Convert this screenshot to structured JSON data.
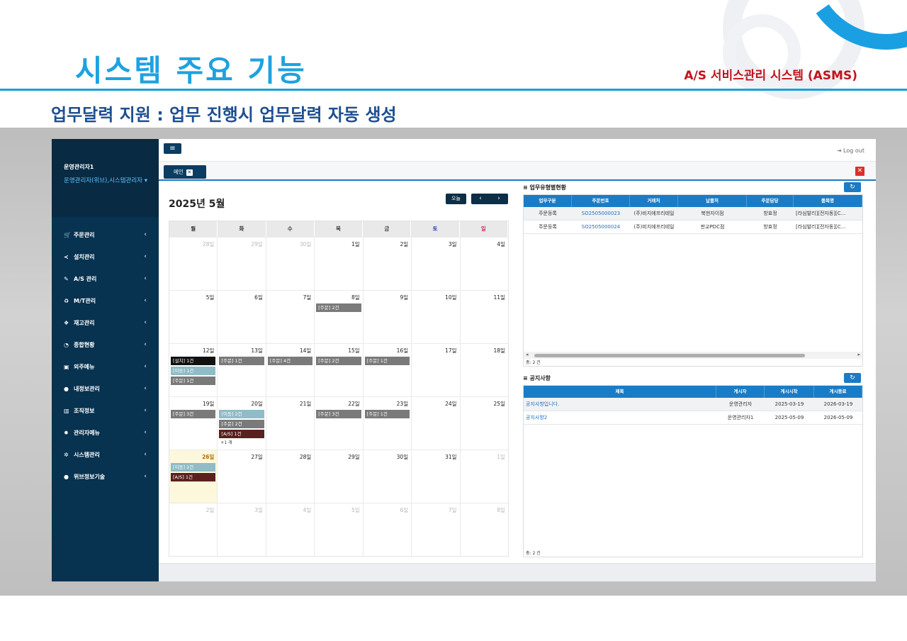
{
  "slide": {
    "title": "시스템 주요 기능",
    "system_name": "A/S 서비스관리 시스템 (ASMS)",
    "subtitle": "업무달력 지원 : 업무 진행시 업무달력 자동 생성"
  },
  "user": {
    "name": "운영관리자1",
    "role": "운영관리자(위브),시스템관리자 ▾"
  },
  "menu": [
    {
      "label": "주문관리",
      "icon": "cart-icon",
      "glyph": "🛒"
    },
    {
      "label": "설치관리",
      "icon": "share-icon",
      "glyph": "≺"
    },
    {
      "label": "A/S 관리",
      "icon": "wrench-icon",
      "glyph": "✎"
    },
    {
      "label": "M/T관리",
      "icon": "recycle-icon",
      "glyph": "♻"
    },
    {
      "label": "재고관리",
      "icon": "cubes-icon",
      "glyph": "❖"
    },
    {
      "label": "종합현황",
      "icon": "pie-chart-icon",
      "glyph": "◔"
    },
    {
      "label": "외주메뉴",
      "icon": "briefcase-icon",
      "glyph": "▣"
    },
    {
      "label": "내정보관리",
      "icon": "user-icon",
      "glyph": "●"
    },
    {
      "label": "조직정보",
      "icon": "building-icon",
      "glyph": "▥"
    },
    {
      "label": "관리자메뉴",
      "icon": "gear-icon",
      "glyph": "✹"
    },
    {
      "label": "시스템관리",
      "icon": "gears-icon",
      "glyph": "✲"
    },
    {
      "label": "위브정보기술",
      "icon": "circle-icon",
      "glyph": "●"
    }
  ],
  "topbar": {
    "menu_toggle": "≡",
    "logout_label": "⇥ Log out"
  },
  "tabs": {
    "main_tab_label": "메인",
    "close_glyph": "✕"
  },
  "calendar": {
    "title": "2025년 5월",
    "today_label": "오늘",
    "prev_glyph": "‹",
    "next_glyph": "›",
    "weekdays": [
      "월",
      "화",
      "수",
      "목",
      "금",
      "토",
      "일"
    ],
    "weeks": [
      [
        {
          "day": "28일",
          "other": true,
          "events": []
        },
        {
          "day": "29일",
          "other": true,
          "events": []
        },
        {
          "day": "30일",
          "other": true,
          "events": []
        },
        {
          "day": "1일",
          "events": []
        },
        {
          "day": "2일",
          "events": []
        },
        {
          "day": "3일",
          "events": []
        },
        {
          "day": "4일",
          "events": []
        }
      ],
      [
        {
          "day": "5일",
          "events": []
        },
        {
          "day": "6일",
          "events": []
        },
        {
          "day": "7일",
          "events": []
        },
        {
          "day": "8일",
          "events": [
            {
              "type": "order",
              "label": "[주문] 2건"
            }
          ]
        },
        {
          "day": "9일",
          "events": []
        },
        {
          "day": "10일",
          "events": []
        },
        {
          "day": "11일",
          "events": []
        }
      ],
      [
        {
          "day": "12일",
          "events": [
            {
              "type": "install",
              "label": "[설치] 1건"
            },
            {
              "type": "move",
              "label": "[이동] 1건"
            },
            {
              "type": "order",
              "label": "[주문] 1건"
            }
          ]
        },
        {
          "day": "13일",
          "events": [
            {
              "type": "order",
              "label": "[주문] 1건"
            }
          ]
        },
        {
          "day": "14일",
          "events": [
            {
              "type": "order",
              "label": "[주문] 4건"
            }
          ]
        },
        {
          "day": "15일",
          "events": [
            {
              "type": "order",
              "label": "[주문] 2건"
            }
          ]
        },
        {
          "day": "16일",
          "events": [
            {
              "type": "order",
              "label": "[주문] 1건"
            }
          ]
        },
        {
          "day": "17일",
          "events": []
        },
        {
          "day": "18일",
          "events": []
        }
      ],
      [
        {
          "day": "19일",
          "events": [
            {
              "type": "order",
              "label": "[주문] 3건"
            }
          ]
        },
        {
          "day": "20일",
          "events": [
            {
              "type": "move",
              "label": "[이동] 2건"
            },
            {
              "type": "order",
              "label": "[주문] 2건"
            },
            {
              "type": "as",
              "label": "[A/S] 1건"
            }
          ],
          "more": "+1 개"
        },
        {
          "day": "21일",
          "events": []
        },
        {
          "day": "22일",
          "events": [
            {
              "type": "order",
              "label": "[주문] 3건"
            }
          ]
        },
        {
          "day": "23일",
          "events": [
            {
              "type": "order",
              "label": "[주문] 1건"
            }
          ]
        },
        {
          "day": "24일",
          "events": []
        },
        {
          "day": "25일",
          "events": []
        }
      ],
      [
        {
          "day": "26일",
          "today": true,
          "events": [
            {
              "type": "move",
              "label": "[이동] 2건"
            },
            {
              "type": "as",
              "label": "[A/S] 1건"
            }
          ]
        },
        {
          "day": "27일",
          "events": []
        },
        {
          "day": "28일",
          "events": []
        },
        {
          "day": "29일",
          "events": []
        },
        {
          "day": "30일",
          "events": []
        },
        {
          "day": "31일",
          "events": []
        },
        {
          "day": "1일",
          "other": true,
          "events": []
        }
      ],
      [
        {
          "day": "2일",
          "other": true,
          "events": []
        },
        {
          "day": "3일",
          "other": true,
          "events": []
        },
        {
          "day": "4일",
          "other": true,
          "events": []
        },
        {
          "day": "5일",
          "other": true,
          "events": []
        },
        {
          "day": "6일",
          "other": true,
          "events": []
        },
        {
          "day": "7일",
          "other": true,
          "events": []
        },
        {
          "day": "8일",
          "other": true,
          "events": []
        }
      ]
    ]
  },
  "work_panel": {
    "title": "≡ 업무유형별현황",
    "refresh_glyph": "↻",
    "columns": [
      "업무구분",
      "주문번호",
      "거래처",
      "납품처",
      "주문담당",
      "품목명"
    ],
    "rows": [
      [
        "주문등록",
        "SO2505000023",
        "(주)비지에프리테일",
        "북현자이점",
        "방효정",
        "[라심발리][전자동][C..."
      ],
      [
        "주문등록",
        "SO2505000024",
        "(주)비지에프리테일",
        "판교PDC점",
        "방효정",
        "[라심발리][전자동][C..."
      ]
    ],
    "total": "총: 2 건"
  },
  "notice_panel": {
    "title": "≡ 공지사항",
    "refresh_glyph": "↻",
    "columns": [
      "제목",
      "게시자",
      "게시시작",
      "게시종료"
    ],
    "rows": [
      [
        "공지사항입니다.",
        "운영관리자",
        "2025-03-19",
        "2026-03-19"
      ],
      [
        "공지사항2",
        "운영관리자1",
        "2025-05-09",
        "2026-05-09"
      ]
    ],
    "total": "총: 2 건"
  }
}
